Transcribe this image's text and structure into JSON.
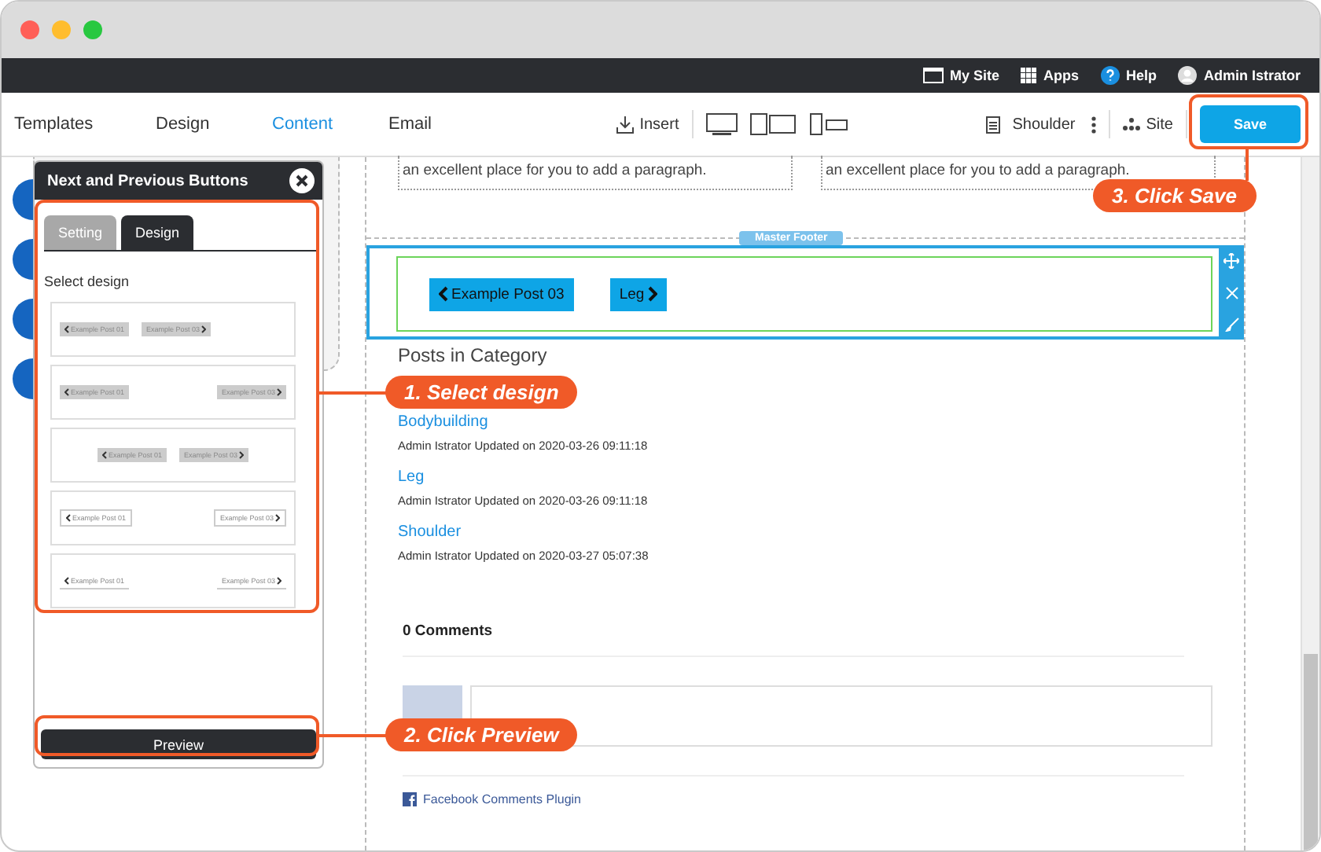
{
  "topbar": {
    "links": [
      {
        "kind": "site",
        "label": "My Site"
      },
      {
        "kind": "apps",
        "label": "Apps"
      },
      {
        "kind": "help",
        "label": "Help"
      },
      {
        "kind": "user",
        "label": "Admin Istrator"
      }
    ]
  },
  "nav": {
    "tabs": [
      {
        "label": "Templates",
        "selected": false
      },
      {
        "label": "Design",
        "selected": false
      },
      {
        "label": "Content",
        "selected": true
      },
      {
        "label": "Email",
        "selected": false
      }
    ],
    "insert": "Insert",
    "page": "Shoulder",
    "site": "Site",
    "save": "Save"
  },
  "panel": {
    "title": "Next and Previous Buttons",
    "tabs": [
      {
        "label": "Setting",
        "selected": false
      },
      {
        "label": "Design",
        "selected": true
      }
    ],
    "heading": "Select design",
    "designs": [
      {
        "kind": "grey-together",
        "prev": "Example Post 01",
        "next": "Example Post 03"
      },
      {
        "kind": "grey-split",
        "prev": "Example Post 01",
        "next": "Example Post 03"
      },
      {
        "kind": "grey-center",
        "prev": "Example Post 01",
        "next": "Example Post 03"
      },
      {
        "kind": "outline-split",
        "prev": "Example Post 01",
        "next": "Example Post 03"
      },
      {
        "kind": "plain-split",
        "prev": "Example Post 01",
        "next": "Example Post 03"
      }
    ],
    "preview": "Preview"
  },
  "canvas": {
    "text_boxes": [
      "an excellent place for you to add a paragraph.",
      "an excellent place for you to add a paragraph."
    ],
    "footer_label": "Master Footer",
    "prev_button": "Example Post 03",
    "next_button": "Leg",
    "section_title": "Posts in Category",
    "posts": [
      {
        "title": "Bodybuilding",
        "meta": "Admin Istrator Updated on 2020-03-26 09:11:18"
      },
      {
        "title": "Leg",
        "meta": "Admin Istrator Updated on 2020-03-26 09:11:18"
      },
      {
        "title": "Shoulder",
        "meta": "Admin Istrator Updated on 2020-03-27 05:07:38"
      }
    ],
    "comments_count": "0 Comments",
    "plugin_link": "Facebook Comments Plugin"
  },
  "callouts": [
    {
      "kind": "design",
      "text": "1. Select design"
    },
    {
      "kind": "preview",
      "text": "2. Click Preview"
    },
    {
      "kind": "save",
      "text": "3. Click Save"
    }
  ]
}
